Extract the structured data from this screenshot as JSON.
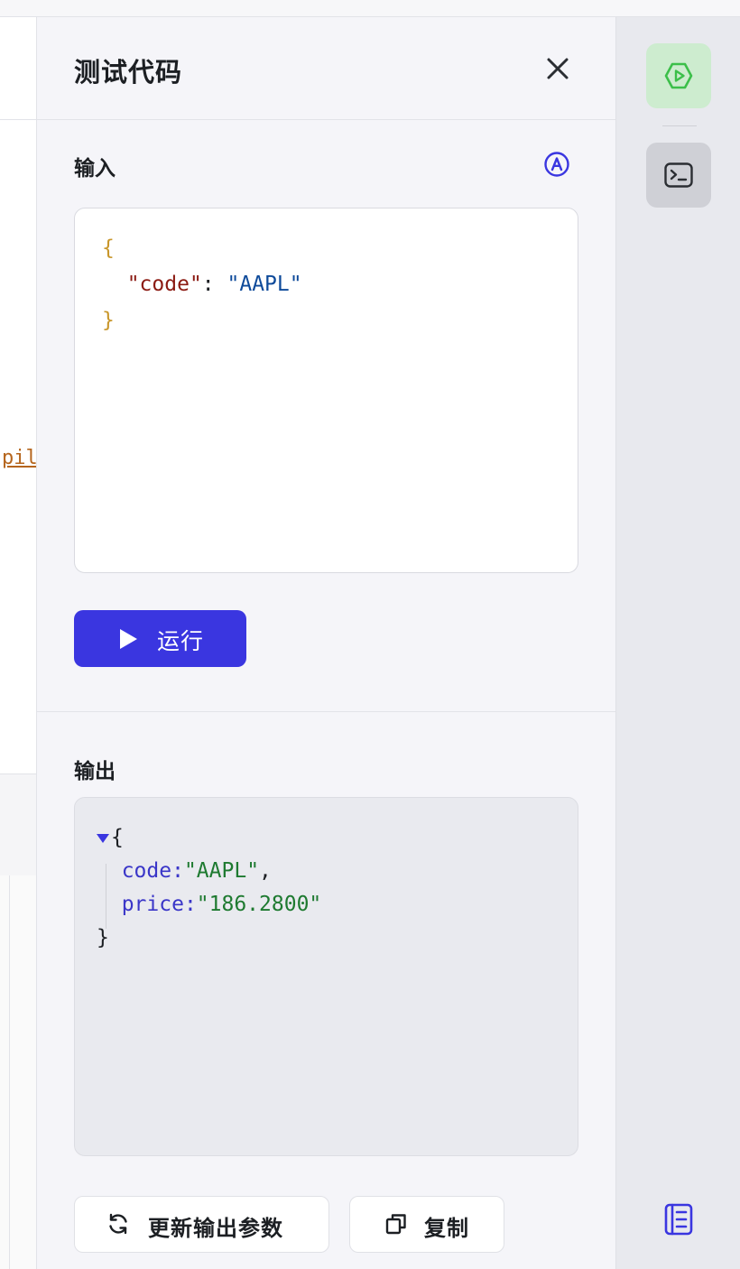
{
  "editor": {
    "visible_fragment": "pil"
  },
  "panel": {
    "title": "测试代码",
    "input": {
      "label": "输入",
      "code_lines": [
        {
          "open": "{"
        },
        {
          "key": "\"code\"",
          "sep": ": ",
          "value": "\"AAPL\""
        },
        {
          "close": "}"
        }
      ],
      "run_label": "运行"
    },
    "output": {
      "label": "输出",
      "open": "{",
      "rows": [
        {
          "key": "code:",
          "value": "\"AAPL\"",
          "trail": ","
        },
        {
          "key": "price:",
          "value": "\"186.2800\"",
          "trail": ""
        }
      ],
      "close": "}",
      "update_label": "更新输出参数",
      "copy_label": "复制"
    }
  },
  "colors": {
    "accent": "#3a36e0",
    "rail_active_bg": "#cdeccf",
    "rail_active_icon": "#3cbf4a"
  },
  "icons": {
    "close": "close-icon",
    "ai": "ai-assist-icon",
    "run": "play-icon",
    "refresh": "refresh-icon",
    "copy": "copy-icon",
    "rail_test": "hexagon-play-icon",
    "rail_terminal": "terminal-icon",
    "rail_bottom": "document-list-icon"
  }
}
